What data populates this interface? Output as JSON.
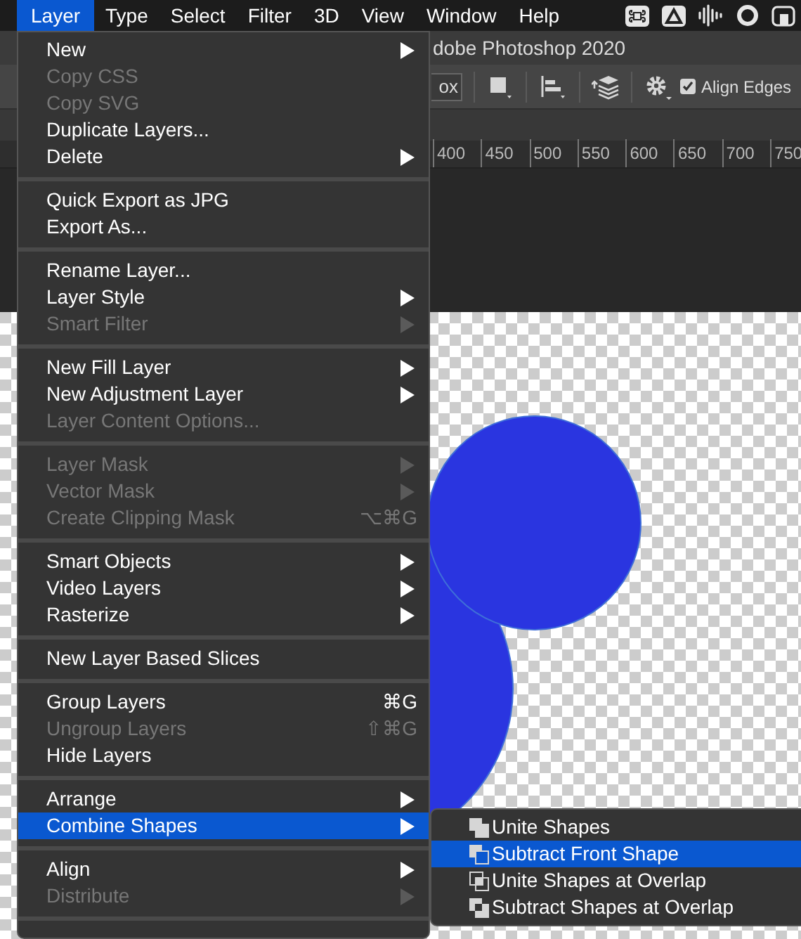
{
  "menubar": {
    "items": [
      {
        "label": "Layer",
        "selected": true
      },
      {
        "label": "Type",
        "selected": false
      },
      {
        "label": "Select",
        "selected": false
      },
      {
        "label": "Filter",
        "selected": false
      },
      {
        "label": "3D",
        "selected": false
      },
      {
        "label": "View",
        "selected": false
      },
      {
        "label": "Window",
        "selected": false
      },
      {
        "label": "Help",
        "selected": false
      }
    ]
  },
  "window": {
    "title": "dobe Photoshop 2020"
  },
  "options_bar": {
    "unit_field": "ox",
    "align_edges": {
      "label": "Align Edges",
      "checked": true
    }
  },
  "ruler": [
    "400",
    "450",
    "500",
    "550",
    "600",
    "650",
    "700",
    "750"
  ],
  "menu": {
    "sections": [
      {
        "items": [
          {
            "label": "New",
            "disabled": false,
            "submenu": true,
            "selected": false
          },
          {
            "label": "Copy CSS",
            "disabled": true,
            "submenu": false,
            "selected": false
          },
          {
            "label": "Copy SVG",
            "disabled": true,
            "submenu": false,
            "selected": false
          },
          {
            "label": "Duplicate Layers...",
            "disabled": false,
            "submenu": false,
            "selected": false
          },
          {
            "label": "Delete",
            "disabled": false,
            "submenu": true,
            "selected": false
          }
        ]
      },
      {
        "items": [
          {
            "label": "Quick Export as JPG",
            "disabled": false,
            "submenu": false,
            "selected": false
          },
          {
            "label": "Export As...",
            "disabled": false,
            "submenu": false,
            "selected": false
          }
        ]
      },
      {
        "items": [
          {
            "label": "Rename Layer...",
            "disabled": false,
            "submenu": false,
            "selected": false
          },
          {
            "label": "Layer Style",
            "disabled": false,
            "submenu": true,
            "selected": false
          },
          {
            "label": "Smart Filter",
            "disabled": true,
            "submenu": true,
            "selected": false
          }
        ]
      },
      {
        "items": [
          {
            "label": "New Fill Layer",
            "disabled": false,
            "submenu": true,
            "selected": false
          },
          {
            "label": "New Adjustment Layer",
            "disabled": false,
            "submenu": true,
            "selected": false
          },
          {
            "label": "Layer Content Options...",
            "disabled": true,
            "submenu": false,
            "selected": false
          }
        ]
      },
      {
        "items": [
          {
            "label": "Layer Mask",
            "disabled": true,
            "submenu": true,
            "selected": false
          },
          {
            "label": "Vector Mask",
            "disabled": true,
            "submenu": true,
            "selected": false
          },
          {
            "label": "Create Clipping Mask",
            "disabled": true,
            "submenu": false,
            "selected": false,
            "shortcut": "⌥⌘G"
          }
        ]
      },
      {
        "items": [
          {
            "label": "Smart Objects",
            "disabled": false,
            "submenu": true,
            "selected": false
          },
          {
            "label": "Video Layers",
            "disabled": false,
            "submenu": true,
            "selected": false
          },
          {
            "label": "Rasterize",
            "disabled": false,
            "submenu": true,
            "selected": false
          }
        ]
      },
      {
        "items": [
          {
            "label": "New Layer Based Slices",
            "disabled": false,
            "submenu": false,
            "selected": false
          }
        ]
      },
      {
        "items": [
          {
            "label": "Group Layers",
            "disabled": false,
            "submenu": false,
            "selected": false,
            "shortcut": "⌘G"
          },
          {
            "label": "Ungroup Layers",
            "disabled": true,
            "submenu": false,
            "selected": false,
            "shortcut": "⇧⌘G"
          },
          {
            "label": "Hide Layers",
            "disabled": false,
            "submenu": false,
            "selected": false
          }
        ]
      },
      {
        "items": [
          {
            "label": "Arrange",
            "disabled": false,
            "submenu": true,
            "selected": false
          },
          {
            "label": "Combine Shapes",
            "disabled": false,
            "submenu": true,
            "selected": true
          }
        ]
      },
      {
        "items": [
          {
            "label": "Align",
            "disabled": false,
            "submenu": true,
            "selected": false
          },
          {
            "label": "Distribute",
            "disabled": true,
            "submenu": true,
            "selected": false
          }
        ]
      }
    ]
  },
  "submenu": {
    "items": [
      {
        "label": "Unite Shapes",
        "selected": false
      },
      {
        "label": "Subtract Front Shape",
        "selected": true
      },
      {
        "label": "Unite Shapes at Overlap",
        "selected": false
      },
      {
        "label": "Subtract Shapes at Overlap",
        "selected": false
      }
    ]
  }
}
